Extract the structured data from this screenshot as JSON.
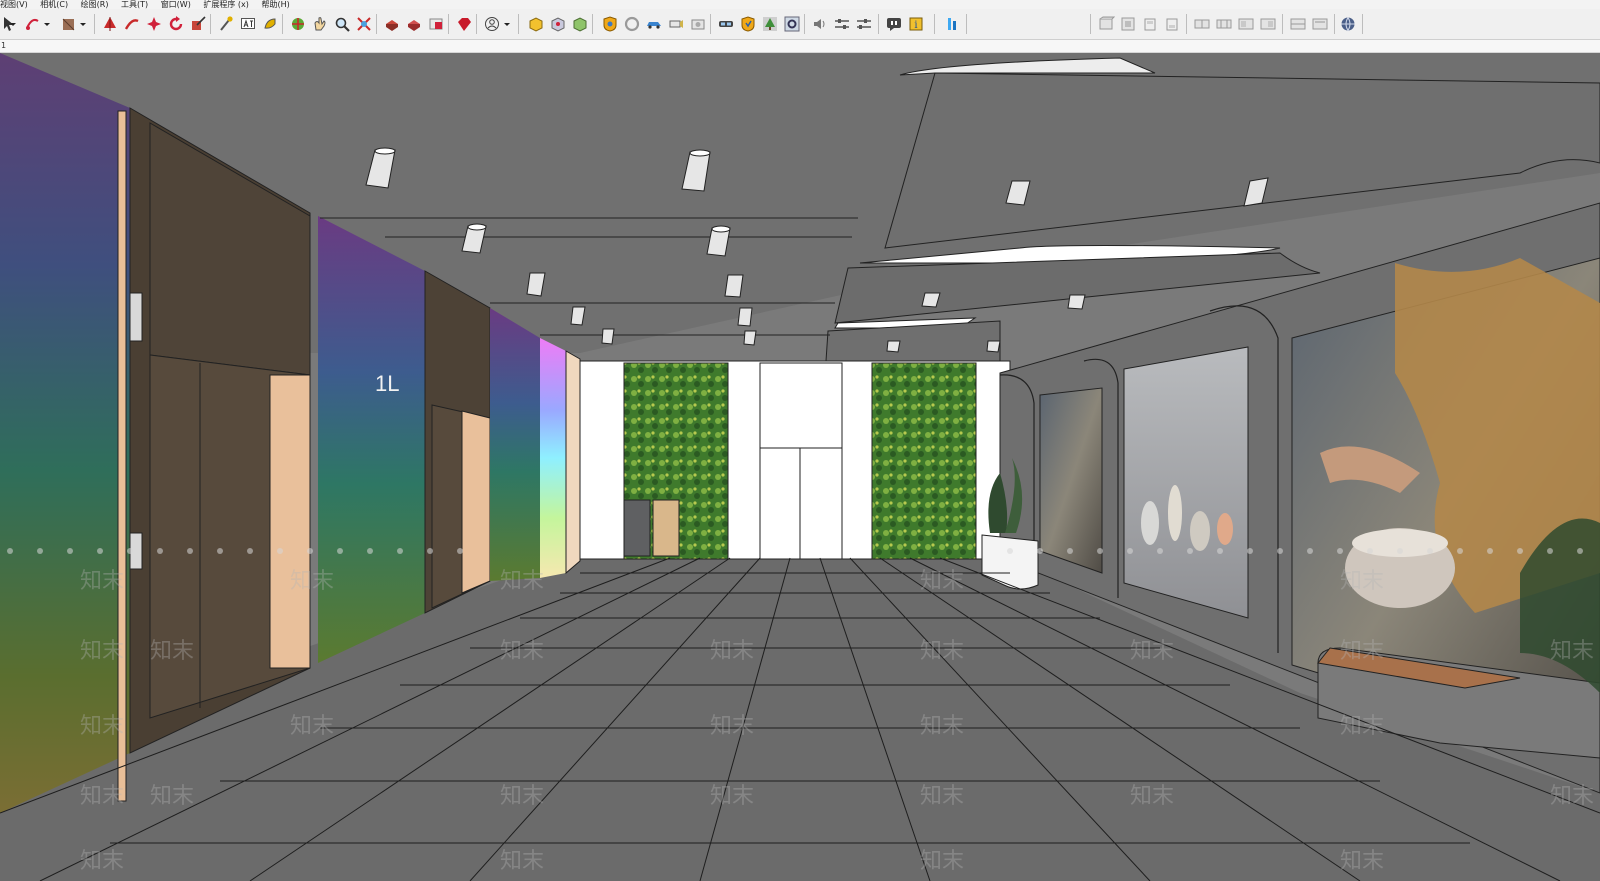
{
  "menu": {
    "items": [
      "视图(V)",
      "相机(C)",
      "绘图(R)",
      "工具(T)",
      "窗口(W)",
      "扩展程序 (x)",
      "帮助(H)"
    ]
  },
  "tabstrip": {
    "label": "1"
  },
  "scene": {
    "floor_sign": "1L",
    "watermark_text": "知末",
    "colors": {
      "ceiling": "#6e6e6e",
      "floor": "#6a6a6a",
      "wood": "#e9bf98",
      "door": "#544a3e",
      "accent": "#3ea9f2"
    }
  },
  "toolbar_icons_left": [
    "select-arrow-icon",
    "dropdown-icon",
    "eraser-icon",
    "dropdown-icon",
    "paint-bucket-icon",
    "dropdown-icon",
    "push-pull-icon",
    "move-icon",
    "rotate-icon",
    "scale-icon",
    "follow-me-icon",
    "tape-measure-icon",
    "text-icon",
    "paint-icon",
    "orbit-icon",
    "pan-icon",
    "zoom-icon",
    "zoom-extents-icon",
    "warehouse-icon",
    "extension-warehouse-icon",
    "layout-icon",
    "ruby-icon",
    "user-icon",
    "dropdown-icon",
    "component-icon",
    "style-icon",
    "material-icon",
    "render-icon",
    "refresh-render-icon",
    "car-icon",
    "camera-path-icon",
    "camera-icon",
    "glasses-icon",
    "shield-icon",
    "tree-icon",
    "gear-icon",
    "speaker-icon",
    "settings-sliders-icon",
    "settings-sliders-icon",
    "chat-icon",
    "info-icon",
    "plugin-icon"
  ],
  "toolbar_icons_right": [
    "view-iso-icon",
    "view-top-icon",
    "view-front-icon",
    "view-right-icon",
    "view-back-icon",
    "view-left-icon",
    "section-icon",
    "section-fill-icon",
    "layout-a-icon",
    "layout-b-icon",
    "globe-icon"
  ]
}
